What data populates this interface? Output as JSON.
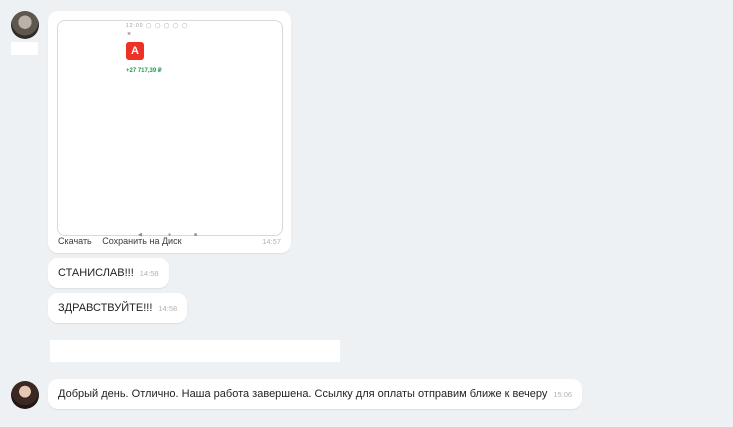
{
  "image_message": {
    "status_bar": "12:00 ◯ ◯ ◯ ◯ ◯",
    "close_glyph": "×",
    "bank_logo_letter": "А",
    "amount": "+27 717,39 ₽",
    "nav_glyphs": [
      "◀",
      "●",
      "■"
    ],
    "download_label": "Скачать",
    "save_label": "Сохранить на Диск",
    "time": "14:57"
  },
  "messages": [
    {
      "text": "СТАНИСЛАВ!!!",
      "time": "14:58"
    },
    {
      "text": "ЗДРАВСТВУЙТЕ!!!",
      "time": "14:58"
    }
  ],
  "reply": {
    "text": "Добрый день. Отлично. Наша работа завершена. Ссылку для оплаты отправим ближе к вечеру",
    "time": "15:06"
  }
}
